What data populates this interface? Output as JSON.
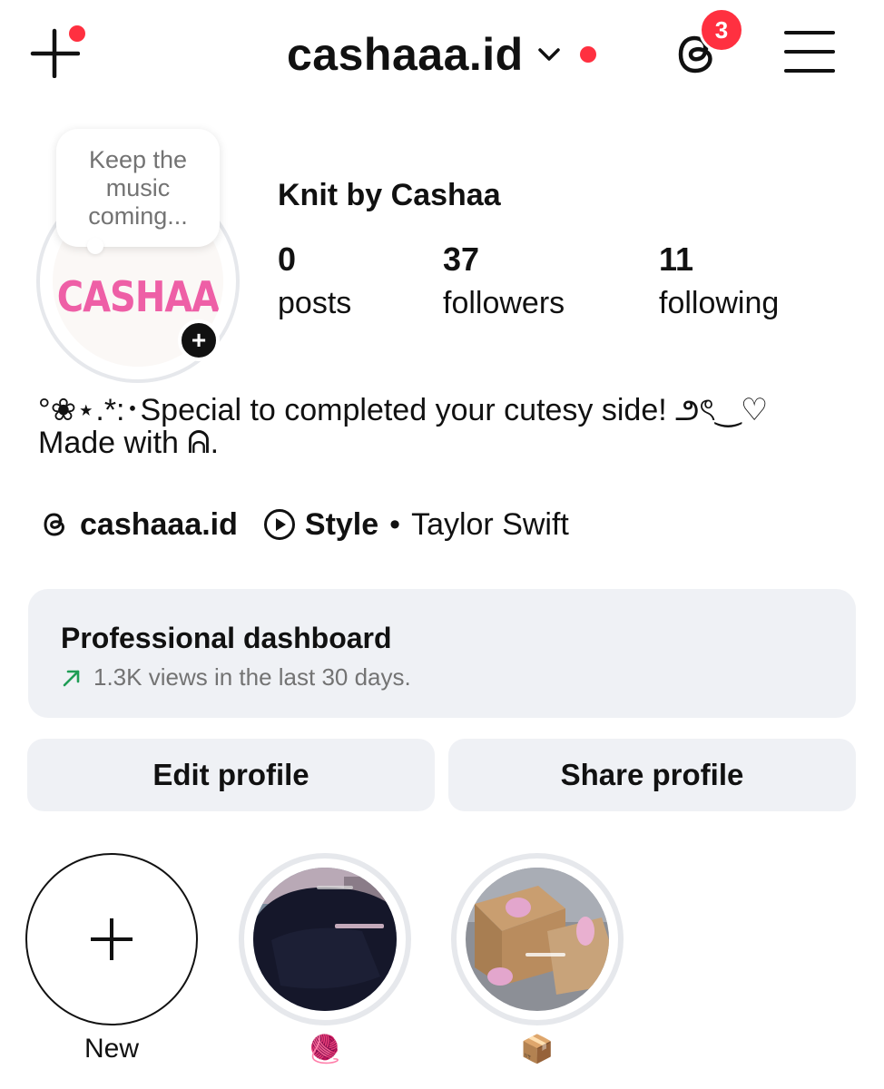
{
  "header": {
    "username": "cashaaa.id",
    "threads_badge_count": "3"
  },
  "profile": {
    "note_text": "Keep the music coming...",
    "avatar_logo_text": "CASHAA",
    "display_name": "Knit by Cashaa",
    "stats": [
      {
        "value": "0",
        "label": "posts"
      },
      {
        "value": "37",
        "label": "followers"
      },
      {
        "value": "11",
        "label": "following"
      }
    ],
    "bio_line1": "°❀⋆.*:･Special to completed your cutesy side! ౨ৎ‿♡",
    "bio_line2": "Made with ᕱ.",
    "threads_handle": "cashaaa.id",
    "music_title": "Style",
    "music_separator": "•",
    "music_artist": "Taylor Swift"
  },
  "dashboard": {
    "title": "Professional dashboard",
    "subtitle": "1.3K views in the last 30 days."
  },
  "actions": {
    "edit_label": "Edit profile",
    "share_label": "Share profile"
  },
  "highlights": [
    {
      "label": "New",
      "icon": "plus-icon"
    },
    {
      "label": "🧶",
      "icon": "yarn-emoji"
    },
    {
      "label": "📦",
      "icon": "package-emoji"
    }
  ],
  "colors": {
    "notification_red": "#ff3040",
    "button_bg": "#eff1f5",
    "logo_pink": "#ee5fa6",
    "trend_green": "#1f9d55"
  }
}
